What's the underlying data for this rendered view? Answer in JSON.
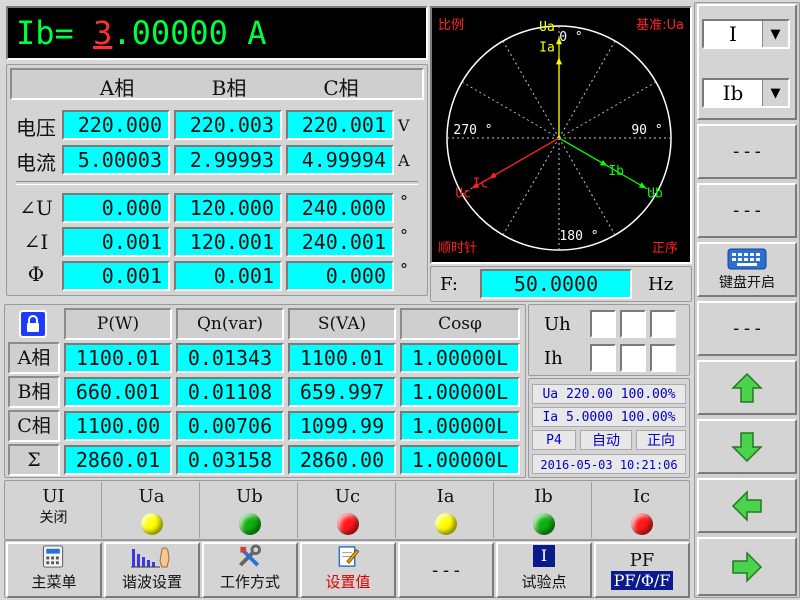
{
  "header": {
    "param_label": "Ib=",
    "digit_first": "3",
    "digit_rest": ".00000",
    "unit": "A"
  },
  "phase_headers": [
    "A相",
    "B相",
    "C相"
  ],
  "voltage": {
    "label": "电压",
    "values": [
      "220.000",
      "220.003",
      "220.001"
    ],
    "unit": "V"
  },
  "current": {
    "label": "电流",
    "values": [
      "5.00003",
      "2.99993",
      "4.99994"
    ],
    "unit": "A"
  },
  "angle_u": {
    "label": "∠U",
    "values": [
      "0.000",
      "120.000",
      "240.000"
    ],
    "unit": "°"
  },
  "angle_i": {
    "label": "∠I",
    "values": [
      "0.001",
      "120.001",
      "240.001"
    ],
    "unit": "°"
  },
  "phi": {
    "label": "Φ",
    "values": [
      "0.001",
      "0.001",
      "0.000"
    ],
    "unit": "°"
  },
  "vector": {
    "scale_label": "比例",
    "reference_label": "基准:Ua",
    "direction_label": "顺时针",
    "sequence_label": "正序",
    "angle_labels": {
      "top": "0 °",
      "right": "90 °",
      "bottom": "180 °",
      "left": "270 °"
    },
    "vectors": [
      {
        "name": "Ua",
        "angle": 0,
        "length": 0.9,
        "color": "#ffff00"
      },
      {
        "name": "Ub",
        "angle": 120,
        "length": 0.9,
        "color": "#00ff00"
      },
      {
        "name": "Uc",
        "angle": 240,
        "length": 0.9,
        "color": "#ff2020"
      },
      {
        "name": "Ia",
        "angle": 0,
        "length": 0.72,
        "color": "#ffff00"
      },
      {
        "name": "Ib",
        "angle": 120,
        "length": 0.5,
        "color": "#00ff00"
      },
      {
        "name": "Ic",
        "angle": 240,
        "length": 0.72,
        "color": "#ff2020"
      }
    ],
    "colors": {
      "background": "#000000",
      "circle": "#ffffff",
      "scale_text": "#ff2020",
      "angle_text": "#ffffff"
    }
  },
  "frequency": {
    "label": "F:",
    "value": "50.0000",
    "unit": "Hz"
  },
  "power_table": {
    "headers": [
      "P(W)",
      "Qn(var)",
      "S(VA)",
      "Cosφ"
    ],
    "rows": [
      {
        "label": "A相",
        "values": [
          "1100.01",
          "0.01343",
          "1100.01",
          "1.00000L"
        ]
      },
      {
        "label": "B相",
        "values": [
          "660.001",
          "0.01108",
          "659.997",
          "1.00000L"
        ]
      },
      {
        "label": "C相",
        "values": [
          "1100.00",
          "0.00706",
          "1099.99",
          "1.00000L"
        ]
      },
      {
        "label": "Σ",
        "values": [
          "2860.01",
          "0.03158",
          "2860.00",
          "1.00000L"
        ]
      }
    ]
  },
  "harmonic": {
    "uh_label": "Uh",
    "ih_label": "Ih"
  },
  "status": {
    "ua_line": "Ua 220.00 100.00%",
    "ia_line": "Ia 5.0000 100.00%",
    "page": "P4",
    "mode": "自动",
    "direction": "正向",
    "datetime": "2016-05-03 10:21:06"
  },
  "indicators": {
    "ui_label": "UI",
    "ui_state": "关闭",
    "lamps": [
      {
        "label": "Ua",
        "color": "#ffff00"
      },
      {
        "label": "Ub",
        "color": "#10b010"
      },
      {
        "label": "Uc",
        "color": "#ff1a1a"
      },
      {
        "label": "Ia",
        "color": "#ffff00"
      },
      {
        "label": "Ib",
        "color": "#10b010"
      },
      {
        "label": "Ic",
        "color": "#ff1a1a"
      }
    ]
  },
  "sidebar": {
    "select1": "I",
    "select2": "Ib",
    "dash": "---",
    "keyboard_label": "键盘开启"
  },
  "toolbar": {
    "main_menu": "主菜单",
    "harmonic_settings": "谐波设置",
    "work_mode": "工作方式",
    "set_value": "设置值",
    "dash": "---",
    "test_point_icon_text": "I",
    "test_point": "试验点",
    "pf_top": "PF",
    "pf_bottom": "PF/Φ/F"
  }
}
